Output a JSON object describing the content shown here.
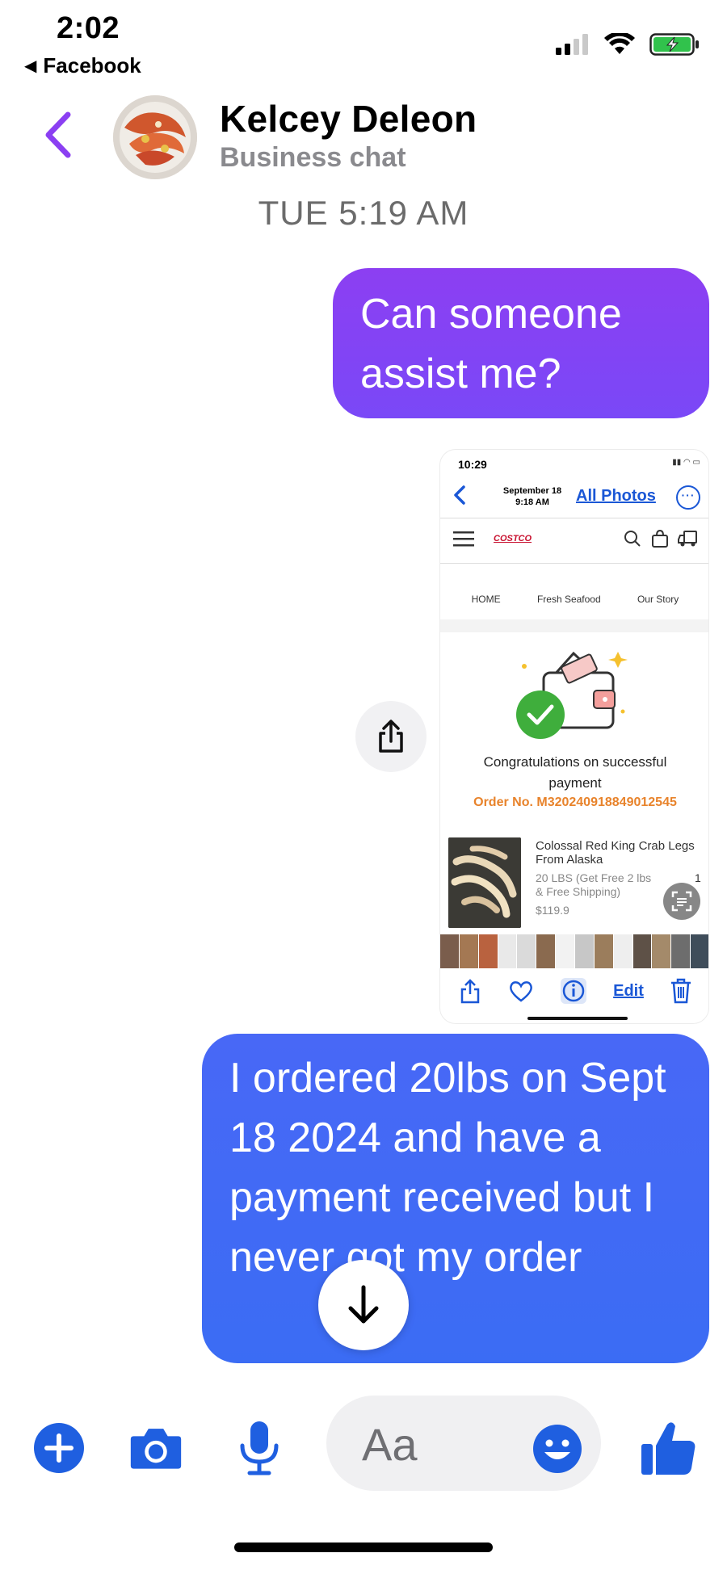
{
  "status_bar": {
    "time": "2:02",
    "back_app_label": "Facebook",
    "icons": [
      "cellular-signal-icon",
      "wifi-icon",
      "battery-charging-icon"
    ],
    "colors": {
      "battery": "#31c24c"
    }
  },
  "header": {
    "contact_name": "Kelcey Deleon",
    "subtitle": "Business chat",
    "back_icon_color": "#8b3ff2"
  },
  "conversation": {
    "timestamp": "TUE 5:19 AM",
    "messages": [
      {
        "from": "me",
        "type": "text",
        "text": "Can someone assist me?",
        "color": "#8640f4"
      },
      {
        "from": "me",
        "type": "image",
        "alt": "Screenshot of order confirmation"
      },
      {
        "from": "me",
        "type": "text",
        "text": "I ordered 20lbs on Sept 18 2024 and have a payment received but I never got my order",
        "color": "#4268f5"
      }
    ]
  },
  "shared_screenshot": {
    "time": "10:29",
    "date_line1": "September 18",
    "date_line2": "9:18 AM",
    "all_photos": "All Photos",
    "store_logo": "COSTCO",
    "nav": [
      "HOME",
      "Fresh Seafood",
      "Our Story"
    ],
    "success_line1": "Congratulations on successful",
    "success_line2": "payment",
    "order_no": "Order No. M320240918849012545",
    "product_title": "Colossal Red King Crab Legs From Alaska",
    "product_desc": "20 LBS (Get Free 2 lbs & Free Shipping)",
    "product_qty": "1",
    "product_price": "$119.9",
    "edit_label": "Edit"
  },
  "composer": {
    "placeholder": "Aa",
    "accent_color": "#1f5fe0"
  }
}
